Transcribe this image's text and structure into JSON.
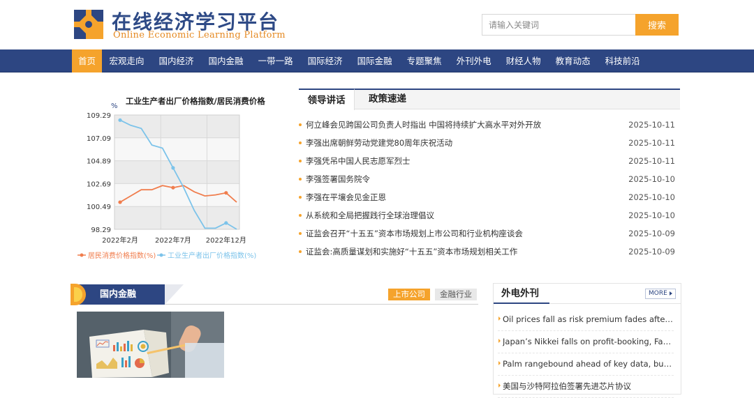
{
  "brand": {
    "title": "在线经济学习平台",
    "subtitle": "Online Economic Learning Platform"
  },
  "search": {
    "placeholder": "请输入关键词",
    "button_label": "搜索"
  },
  "nav": {
    "items": [
      "首页",
      "宏观走向",
      "国内经济",
      "国内金融",
      "一带一路",
      "国际经济",
      "国际金融",
      "专题聚焦",
      "外刊外电",
      "财经人物",
      "教育动态",
      "科技前沿"
    ],
    "active_index": 0
  },
  "colors": {
    "primary": "#2d4682",
    "accent": "#f5a32c",
    "cpi_series": "#f07d4d",
    "ppi_series": "#7cc3ea"
  },
  "chart_data": {
    "type": "line",
    "title": "工业生产者出厂价格指数/居民消费价格",
    "ylabel": "%",
    "yticks": [
      "109.29",
      "107.09",
      "104.89",
      "102.69",
      "100.49",
      "98.29"
    ],
    "ylim": [
      98.29,
      109.29
    ],
    "xticks": [
      "2022年2月",
      "2022年7月",
      "2022年12月"
    ],
    "grid": true,
    "legend": "bottom",
    "x": [
      0,
      1,
      2,
      3,
      4,
      5,
      6,
      7,
      8,
      9,
      10,
      11
    ],
    "series": [
      {
        "name": "居民消费价格指数(%)",
        "color": "#f07d4d",
        "values": [
          100.9,
          101.5,
          102.1,
          102.1,
          102.5,
          102.3,
          102.5,
          101.9,
          101.5,
          101.6,
          101.8,
          100.9
        ]
      },
      {
        "name": "工业生产者出厂价格指数(%)",
        "color": "#7cc3ea",
        "values": [
          108.8,
          108.3,
          108.0,
          106.4,
          106.1,
          104.2,
          102.3,
          100.1,
          98.4,
          98.4,
          98.9,
          98.3
        ]
      }
    ]
  },
  "news": {
    "tabs": [
      "领导讲话",
      "政策速递"
    ],
    "items": [
      {
        "title": "何立峰会见跨国公司负责人时指出 中国将持续扩大高水平对外开放",
        "date": "2025-10-11"
      },
      {
        "title": "李强出席朝鲜劳动党建党80周年庆祝活动",
        "date": "2025-10-11"
      },
      {
        "title": "李强凭吊中国人民志愿军烈士",
        "date": "2025-10-11"
      },
      {
        "title": "李强签署国务院令",
        "date": "2025-10-10"
      },
      {
        "title": "李强在平壤会见金正恩",
        "date": "2025-10-10"
      },
      {
        "title": "从系统和全局把握践行全球治理倡议",
        "date": "2025-10-10"
      },
      {
        "title": "证监会召开“十五五”资本市场规划上市公司和行业机构座谈会",
        "date": "2025-10-09"
      },
      {
        "title": "证监会:高质量谋划和实施好“十五五”资本市场规划相关工作",
        "date": "2025-10-09"
      }
    ]
  },
  "domestic_finance": {
    "title": "国内金融",
    "tabs": [
      "上市公司",
      "金融行业"
    ]
  },
  "foreign": {
    "title": "外电外刊",
    "more_label": "MORE",
    "items": [
      "Oil prices fall as risk premium fades after Gaza peace deal",
      "Japan’s Nikkei falls on profit-booking, Fast Retailing gains",
      "Palm rangebound ahead of key data, but set for weekly gain",
      "美国与沙特阿拉伯签署先进芯片协议"
    ]
  }
}
